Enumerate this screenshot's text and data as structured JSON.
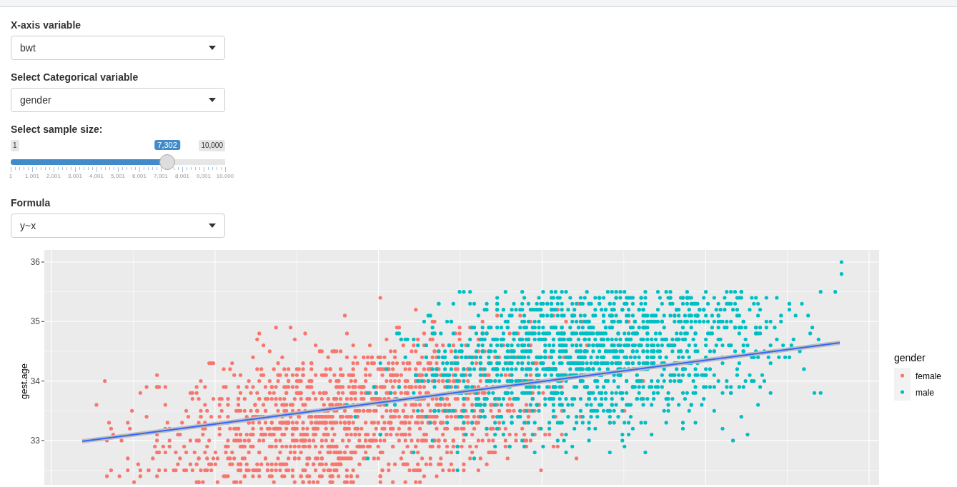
{
  "controls": [
    {
      "kind": "select",
      "label": "X-axis variable",
      "value": "bwt"
    },
    {
      "kind": "select",
      "label": "Select Categorical variable",
      "value": "gender"
    },
    {
      "kind": "slider",
      "label": "Select sample size:",
      "min_label": "1",
      "max_label": "10,000",
      "value_label": "7,302",
      "level": 0.7302,
      "ticks": [
        "1",
        "1,001",
        "2,001",
        "3,001",
        "4,001",
        "5,001",
        "6,001",
        "7,001",
        "8,001",
        "9,001",
        "10,000"
      ]
    },
    {
      "kind": "select",
      "label": "Formula",
      "value": "y~x"
    }
  ],
  "plot": {
    "y_axis_title": "gest.age",
    "y_tick_labels": [
      "36",
      "35",
      "34",
      "33"
    ],
    "legend": {
      "title": "gender",
      "items": [
        {
          "label": "female",
          "color": "#f8766d"
        },
        {
          "label": "male",
          "color": "#00bfc4"
        }
      ]
    }
  }
}
